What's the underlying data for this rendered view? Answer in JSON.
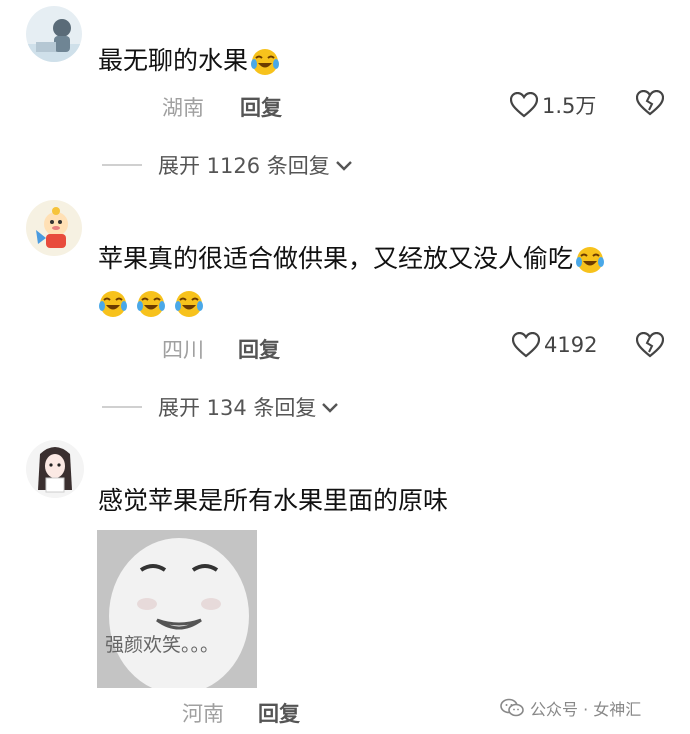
{
  "comments": [
    {
      "text": "最无聊的水果",
      "location": "湖南",
      "reply_label": "回复",
      "likes": "1.5万",
      "expand_label": "展开 1126 条回复"
    },
    {
      "text_line1": "苹果真的很适合做供果，又经放又没人偷吃",
      "location": "四川",
      "reply_label": "回复",
      "likes": "4192",
      "expand_label": "展开 134 条回复"
    },
    {
      "text": "感觉苹果是所有水果里面的原味",
      "sticker_caption": "强颜欢笑。。。",
      "location": "河南",
      "reply_label": "回复"
    }
  ],
  "watermark": "公众号 · 女神汇",
  "icons": {
    "emoji": "laughing-crying-emoji-icon",
    "like": "heart-outline-icon",
    "dislike": "broken-heart-icon",
    "expand": "chevron-down-icon",
    "wechat": "wechat-logo-icon"
  },
  "colors": {
    "location": "#a0a0a0",
    "text": "#111111",
    "emoji_face": "#f7c21c",
    "emoji_tear": "#4aa8e8"
  }
}
